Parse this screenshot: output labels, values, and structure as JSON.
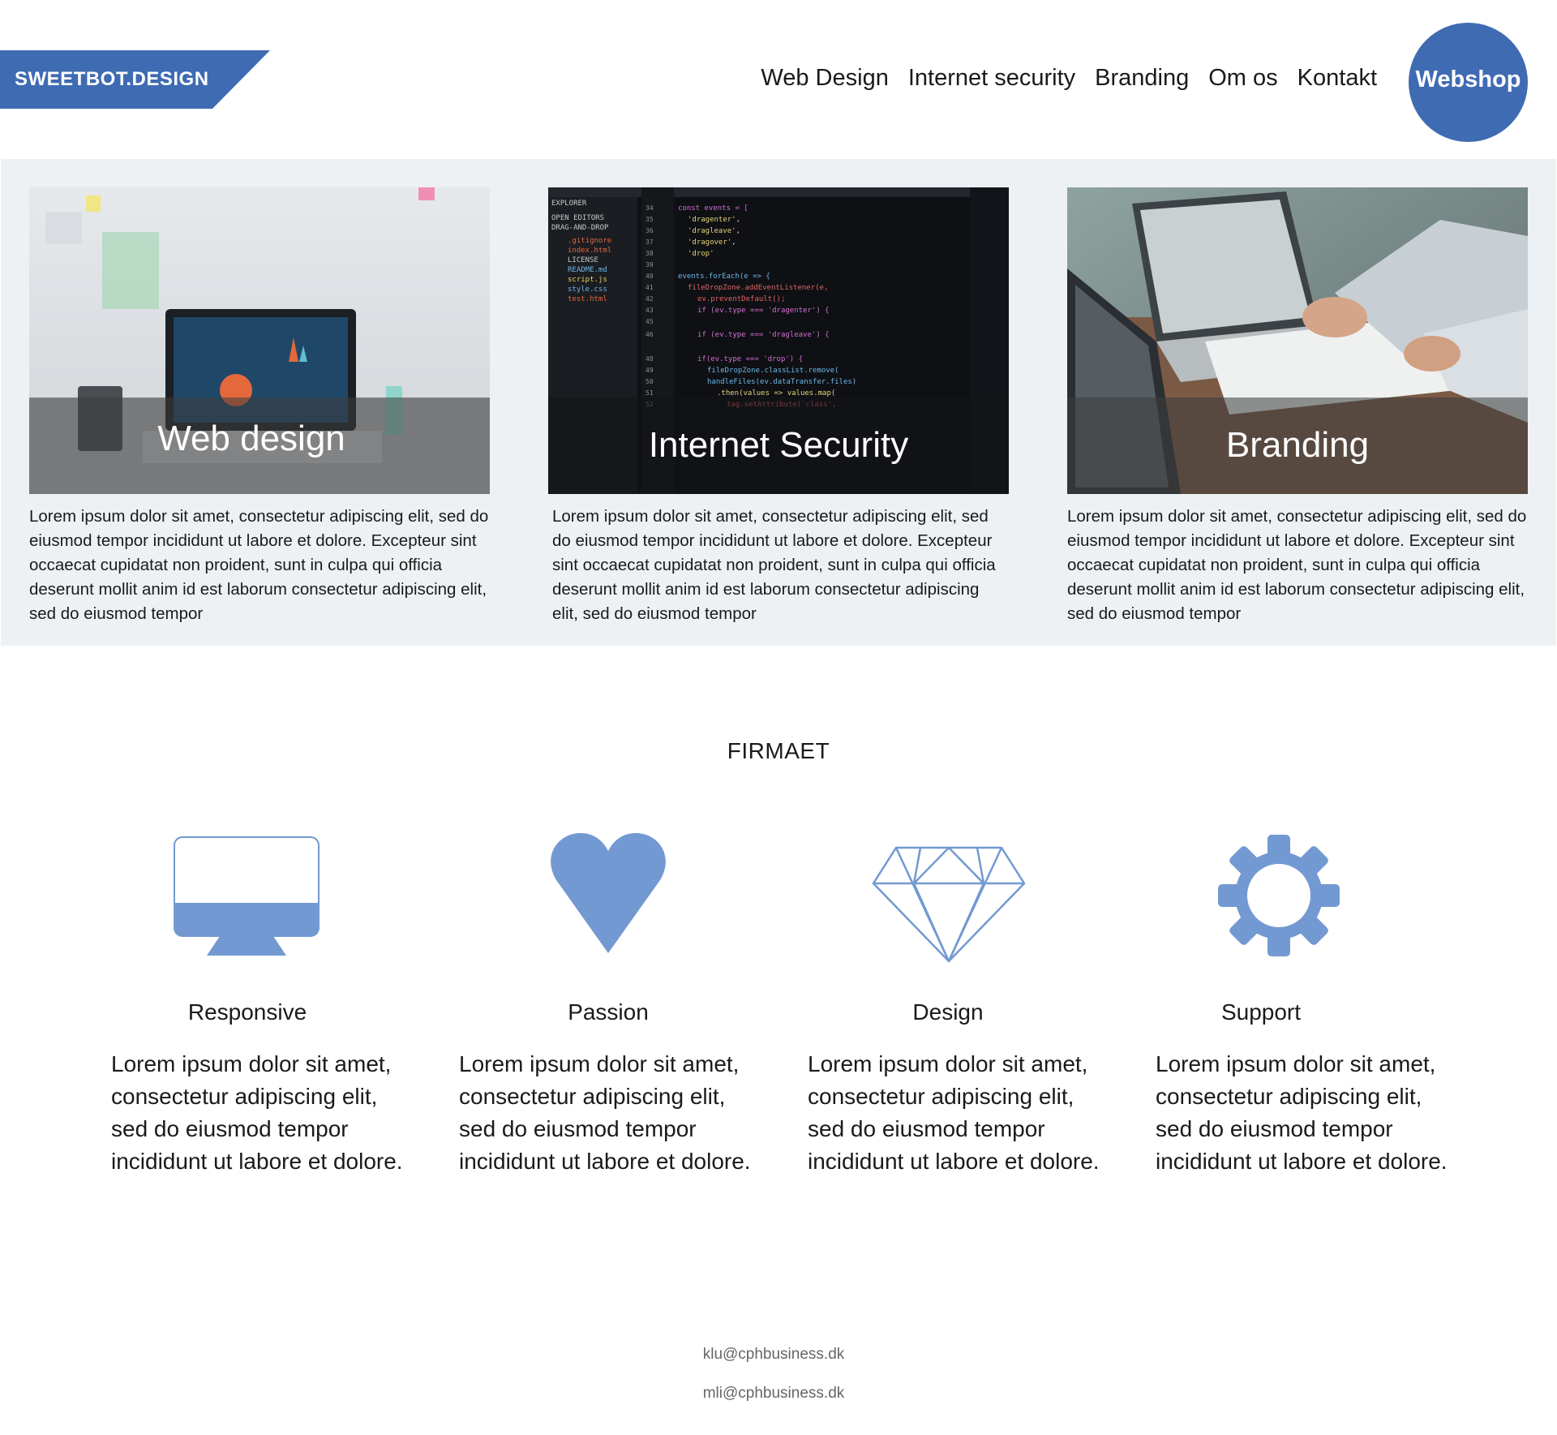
{
  "brand": {
    "logo_text": "SWEETBOT.DESIGN",
    "accent_color": "#3f6bb3",
    "icon_color": "#7399d2"
  },
  "nav": {
    "items": [
      "Web Design",
      "Internet security",
      "Branding",
      "Om os",
      "Kontakt"
    ]
  },
  "webshop_button": "Webshop",
  "services": [
    {
      "title": "Web design",
      "text": "Lorem ipsum dolor sit amet, consectetur adipiscing elit, sed do eiusmod tempor incididunt ut labore et dolore. Excepteur sint occaecat cupidatat non proident, sunt in culpa qui officia deserunt mollit anim id est laborum consectetur adipiscing elit, sed do eiusmod tempor"
    },
    {
      "title": "Internet Security",
      "text": "Lorem ipsum dolor sit amet, consectetur adipiscing elit, sed do eiusmod tempor incididunt ut labore et dolore. Excepteur sint occaecat cupidatat non proident, sunt in culpa qui officia deserunt mollit anim id est laborum consectetur adipiscing elit, sed do eiusmod tempor"
    },
    {
      "title": "Branding",
      "text": "Lorem ipsum dolor sit amet, consectetur adipiscing elit, sed do eiusmod tempor incididunt ut labore et dolore. Excepteur sint occaecat cupidatat non proident, sunt in culpa qui officia deserunt mollit anim id est laborum consectetur adipiscing elit, sed do eiusmod tempor"
    }
  ],
  "firmaet": {
    "title": "FIRMAET",
    "features": [
      {
        "icon": "monitor-icon",
        "name": "Responsive",
        "text": "Lorem ipsum dolor sit amet, consectetur adipiscing elit, sed do eiusmod tempor incididunt ut labore et dolore."
      },
      {
        "icon": "heart-icon",
        "name": "Passion",
        "text": "Lorem ipsum dolor sit amet, consectetur adipiscing elit, sed do eiusmod tempor incididunt ut labore et dolore."
      },
      {
        "icon": "diamond-icon",
        "name": "Design",
        "text": "Lorem ipsum dolor sit amet, consectetur adipiscing elit, sed do eiusmod tempor incididunt ut labore et dolore."
      },
      {
        "icon": "gear-icon",
        "name": "Support",
        "text": "Lorem ipsum dolor sit amet, consectetur adipiscing elit, sed do eiusmod tempor incididunt ut labore et dolore."
      }
    ]
  },
  "footer": {
    "emails": [
      "klu@cphbusiness.dk",
      "mli@cphbusiness.dk"
    ]
  }
}
